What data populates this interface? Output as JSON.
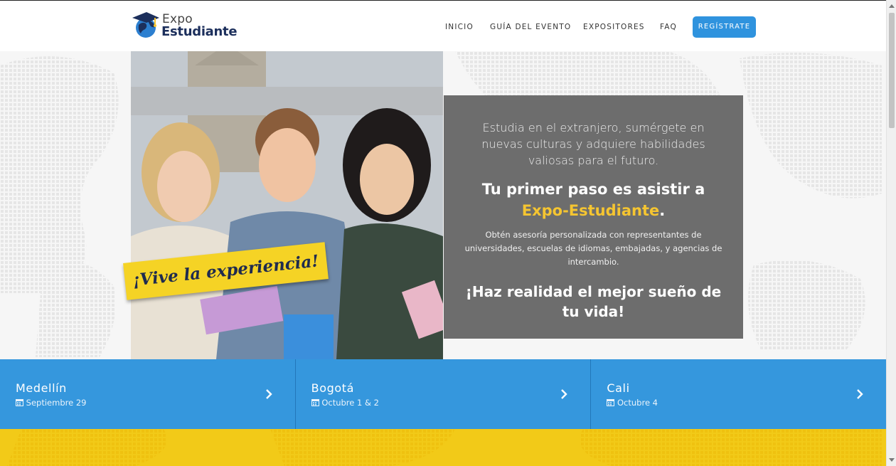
{
  "brand": {
    "name_top": "Expo",
    "name_bottom": "Estudiante",
    "colors": {
      "navy": "#1c2f5c",
      "blue": "#2f93de",
      "yellow": "#f5d325"
    }
  },
  "nav": {
    "items": [
      "INICIO",
      "GUÍA DEL EVENTO",
      "EXPOSITORES",
      "FAQ"
    ],
    "register": "REGÍSTRATE"
  },
  "hero": {
    "banner": "¡Vive la experiencia!",
    "intro": "Estudia en el extranjero, sumérgete en nuevas culturas y adquiere habilidades valiosas para el futuro.",
    "headline_pre": "Tu primer paso es asistir a",
    "headline_highlight": "Expo-Estudiante",
    "headline_post": ".",
    "description": "Obtén asesoría personalizada con representantes de universidades, escuelas de idiomas, embajadas, y agencias de intercambio.",
    "cta": "¡Haz realidad el mejor sueño de tu vida!"
  },
  "cities": [
    {
      "name": "Medellín",
      "date": "Septiembre 29"
    },
    {
      "name": "Bogotá",
      "date": "Octubre 1 & 2"
    },
    {
      "name": "Cali",
      "date": "Octubre 4"
    }
  ],
  "icons": {
    "logo": "graduation-cap-globe-icon",
    "date": "calendar-icon",
    "city_link": "chevron-right-icon"
  }
}
